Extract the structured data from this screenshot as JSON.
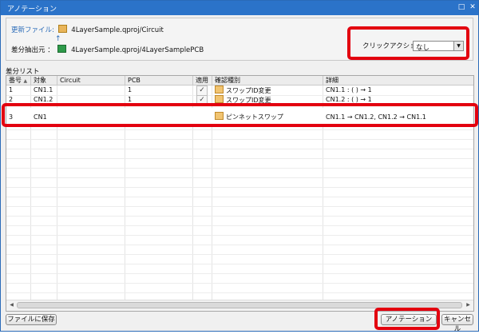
{
  "window": {
    "title": "アノテーション",
    "minimize_glyph": "□",
    "close_glyph": "✕"
  },
  "info": {
    "update_file_label": "更新ファイル:",
    "update_file_value": "4LayerSample.qproj/Circuit",
    "diff_source_label": "差分抽出元 ：",
    "diff_source_value": "4LayerSample.qproj/4LayerSamplePCB",
    "arrow_glyph": "↑"
  },
  "click_action": {
    "label": "クリックアクション",
    "value": "なし"
  },
  "diff_list": {
    "label": "差分リスト",
    "columns": [
      "番号",
      "対象",
      "Circuit",
      "PCB",
      "適用",
      "確認種別",
      "詳細"
    ],
    "sort_glyph": "▲",
    "rows": [
      {
        "no": "1",
        "target": "CN1.1",
        "circuit": "",
        "pcb": "1",
        "applied": true,
        "type": "スワップID変更",
        "detail": "CN1.1 : ( ) → 1"
      },
      {
        "no": "2",
        "target": "CN1.2",
        "circuit": "",
        "pcb": "1",
        "applied": true,
        "type": "スワップID変更",
        "detail": "CN1.2 : ( ) → 1"
      },
      {
        "no": "3",
        "target": "CN1",
        "circuit": "",
        "pcb": "",
        "applied": false,
        "type": "ピンネットスワップ",
        "detail": "CN1.1 → CN1.2, CN1.2 → CN1.1"
      }
    ]
  },
  "buttons": {
    "save_to_file": "ファイルに保存",
    "annotate": "アノテーション",
    "cancel": "キャンセル"
  },
  "highlight_color": "#e3000f",
  "accent_color": "#2b73c9"
}
